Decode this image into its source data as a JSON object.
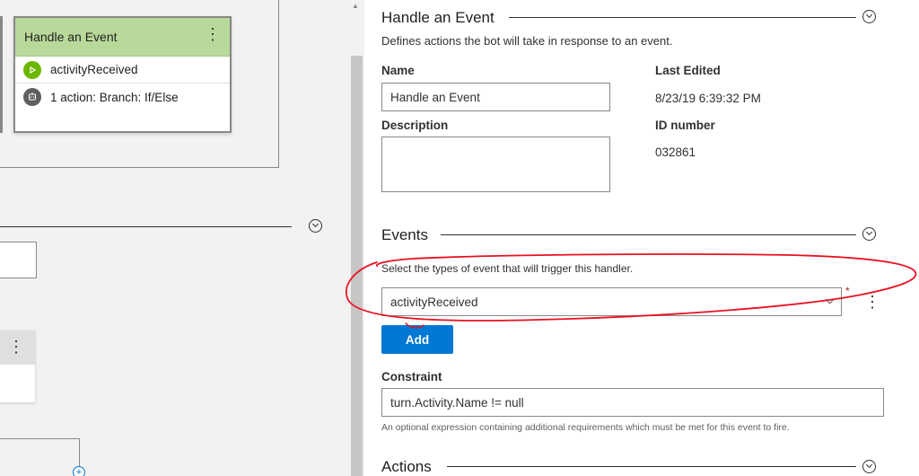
{
  "canvas": {
    "node": {
      "title": "Handle an Event",
      "menu_glyph": "⋮",
      "rows": [
        {
          "icon": "play-icon",
          "label": "activityReceived"
        },
        {
          "icon": "bot-action-icon",
          "label": "1 action: Branch: If/Else"
        }
      ]
    },
    "mini_menu_glyph": "⋮",
    "add_glyph": "+"
  },
  "panel": {
    "header": {
      "title": "Handle an Event",
      "description": "Defines actions the bot will take in response to an event."
    },
    "fields": {
      "name_label": "Name",
      "name_value": "Handle an Event",
      "last_edited_label": "Last Edited",
      "last_edited_value": "8/23/19 6:39:32 PM",
      "description_label": "Description",
      "description_value": "",
      "id_label": "ID number",
      "id_value": "032861"
    },
    "events": {
      "title": "Events",
      "description": "Select the types of event that will trigger this handler.",
      "selected": "activityReceived",
      "required_mark": "*",
      "menu_glyph": "⋮",
      "add_label": "Add"
    },
    "constraint": {
      "label": "Constraint",
      "value": "turn.Activity.Name != null",
      "hint": "An optional expression containing additional requirements which must be met for this event to fire."
    },
    "actions": {
      "title": "Actions"
    }
  },
  "colors": {
    "accent": "#0078d4",
    "node_header": "#b9d99a",
    "annotation": "#e81123"
  }
}
